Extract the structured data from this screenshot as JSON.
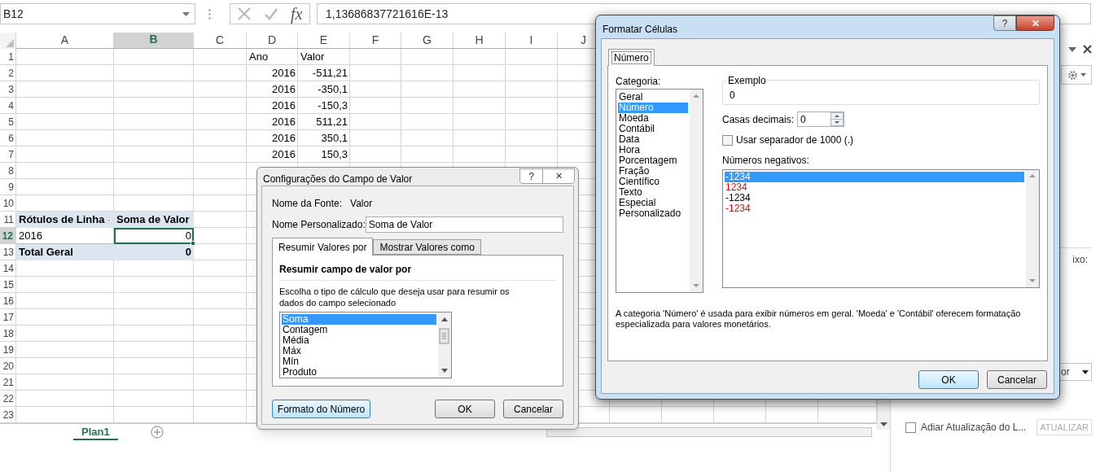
{
  "formula_bar": {
    "name_box": "B12",
    "function_label": "fx",
    "value": "1,13686837721616E-13"
  },
  "sheet": {
    "columns": [
      {
        "label": "A",
        "selected": false
      },
      {
        "label": "B",
        "selected": true
      },
      {
        "label": "C",
        "selected": false
      },
      {
        "label": "D",
        "selected": false
      },
      {
        "label": "E",
        "selected": false
      },
      {
        "label": "F",
        "selected": false
      },
      {
        "label": "G",
        "selected": false
      },
      {
        "label": "H",
        "selected": false
      },
      {
        "label": "I",
        "selected": false
      },
      {
        "label": "J",
        "selected": false
      }
    ],
    "rows": [
      {
        "label": "1",
        "selected": false
      },
      {
        "label": "2",
        "selected": false
      },
      {
        "label": "3",
        "selected": false
      },
      {
        "label": "4",
        "selected": false
      },
      {
        "label": "5",
        "selected": false
      },
      {
        "label": "6",
        "selected": false
      },
      {
        "label": "7",
        "selected": false
      },
      {
        "label": "8",
        "selected": false
      },
      {
        "label": "9",
        "selected": false
      },
      {
        "label": "10",
        "selected": false
      },
      {
        "label": "11",
        "selected": false
      },
      {
        "label": "12",
        "selected": true
      },
      {
        "label": "13",
        "selected": false
      },
      {
        "label": "14",
        "selected": false
      },
      {
        "label": "15",
        "selected": false
      },
      {
        "label": "16",
        "selected": false
      },
      {
        "label": "17",
        "selected": false
      },
      {
        "label": "18",
        "selected": false
      },
      {
        "label": "19",
        "selected": false
      },
      {
        "label": "20",
        "selected": false
      },
      {
        "label": "21",
        "selected": false
      },
      {
        "label": "22",
        "selected": false
      },
      {
        "label": "23",
        "selected": false
      }
    ],
    "data_table": {
      "headers": [
        "Ano",
        "Valor"
      ],
      "rows": [
        [
          "2016",
          "-511,21"
        ],
        [
          "2016",
          "-350,1"
        ],
        [
          "2016",
          "-150,3"
        ],
        [
          "2016",
          "511,21"
        ],
        [
          "2016",
          "350,1"
        ],
        [
          "2016",
          "150,3"
        ]
      ]
    },
    "pivot_table": {
      "headers": [
        "Rótulos de Linha",
        "Soma de Valor"
      ],
      "rows": [
        {
          "kind": "item",
          "label": "2016",
          "value": "0",
          "selected": true
        },
        {
          "kind": "total",
          "label": "Total Geral",
          "value": "0",
          "selected": false
        }
      ]
    },
    "sheet_tabs": [
      {
        "label": "Plan1",
        "selected": true
      }
    ]
  },
  "task_pane": {
    "partial_label": "ixo:",
    "dropdown_text": "or",
    "defer_update": {
      "label": "Adiar Atualização do L...",
      "checked": false
    },
    "update_button": {
      "label": "ATUALIZAR",
      "disabled": true
    }
  },
  "value_field_dialog": {
    "title": "Configurações do Campo de Valor",
    "help": "?",
    "close": "✕",
    "source_label": "Nome da Fonte:",
    "source_value": "Valor",
    "custom_name_label": "Nome Personalizado:",
    "custom_name": "Soma de Valor",
    "tabs": [
      {
        "label": "Resumir Valores por",
        "selected": true
      },
      {
        "label": "Mostrar Valores como",
        "selected": false
      }
    ],
    "section_title": "Resumir campo de valor por",
    "description": "Escolha o tipo de cálculo que deseja usar para resumir os dados do campo selecionado",
    "functions": [
      {
        "label": "Soma",
        "selected": true
      },
      {
        "label": "Contagem",
        "selected": false
      },
      {
        "label": "Média",
        "selected": false
      },
      {
        "label": "Máx",
        "selected": false
      },
      {
        "label": "Mín",
        "selected": false
      },
      {
        "label": "Produto",
        "selected": false
      }
    ],
    "number_format_button": "Formato do Número",
    "ok_button": "OK",
    "cancel_button": "Cancelar"
  },
  "format_cells_dialog": {
    "title": "Formatar Células",
    "help": "?",
    "close": "✕",
    "tabs": [
      {
        "label": "Número",
        "selected": true
      }
    ],
    "category_label": "Categoria:",
    "categories": [
      {
        "label": "Geral",
        "selected": false
      },
      {
        "label": "Número",
        "selected": true
      },
      {
        "label": "Moeda",
        "selected": false
      },
      {
        "label": "Contábil",
        "selected": false
      },
      {
        "label": "Data",
        "selected": false
      },
      {
        "label": "Hora",
        "selected": false
      },
      {
        "label": "Porcentagem",
        "selected": false
      },
      {
        "label": "Fração",
        "selected": false
      },
      {
        "label": "Científico",
        "selected": false
      },
      {
        "label": "Texto",
        "selected": false
      },
      {
        "label": "Especial",
        "selected": false
      },
      {
        "label": "Personalizado",
        "selected": false
      }
    ],
    "sample_label": "Exemplo",
    "sample_value": "0",
    "decimals_label": "Casas decimais:",
    "decimals": "0",
    "thousands_separator": {
      "label": "Usar separador de 1000 (.)",
      "checked": false
    },
    "negatives_label": "Números negativos:",
    "negatives": [
      {
        "text": "-1234",
        "selected": true
      },
      {
        "text": "1234",
        "color": "#ff0000",
        "selected": false
      },
      {
        "text": "-1234",
        "color": "#000000",
        "selected": false
      },
      {
        "text": "-1234",
        "color": "#ff0000",
        "selected": false
      }
    ],
    "description": "A categoria 'Número' é usada para exibir números em geral. 'Moeda' e 'Contábil' oferecem formatação especializada para valores monetários.",
    "ok_button": "OK",
    "cancel_button": "Cancelar"
  }
}
